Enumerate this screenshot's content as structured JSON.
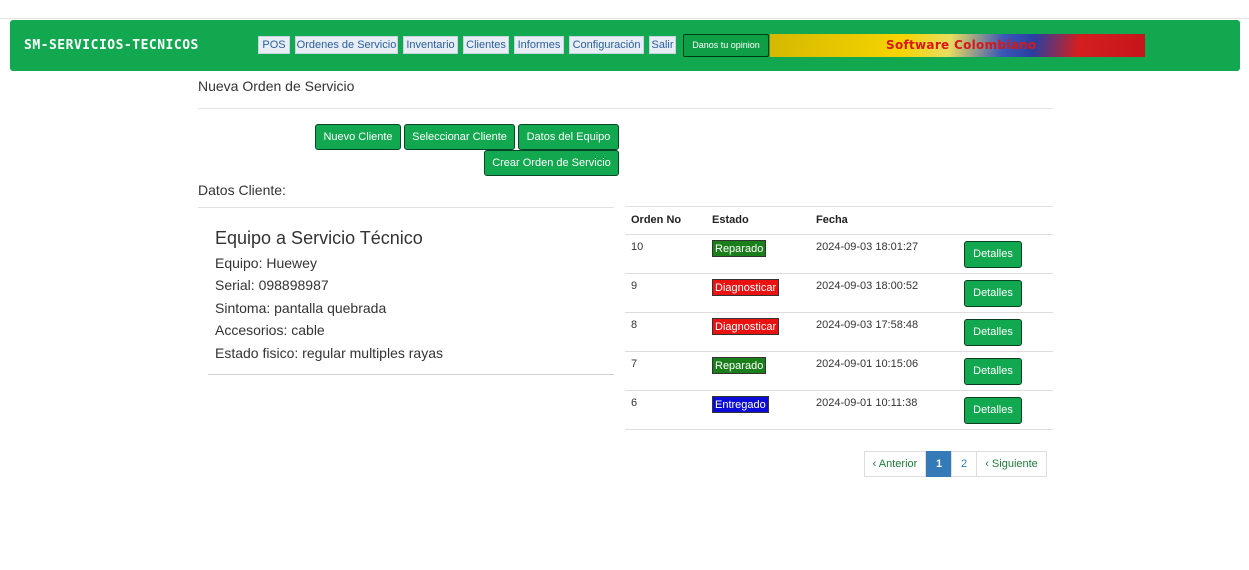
{
  "app": {
    "brand": "SM-SERVICIOS-TECNICOS"
  },
  "nav": {
    "items": [
      "POS",
      "Ordenes de Servicio",
      "Inventario",
      "Clientes",
      "Informes",
      "Configuración",
      "Salir"
    ],
    "opinion": "Danos tu opinion",
    "banner_text": "Software Colombiano"
  },
  "page": {
    "title": "Nueva Orden de Servicio"
  },
  "actions": {
    "nuevo_cliente": "Nuevo Cliente",
    "seleccionar_cliente": "Seleccionar Cliente",
    "datos_equipo": "Datos del Equipo",
    "crear_orden": "Crear Orden de Servicio"
  },
  "cliente": {
    "section_label": "Datos Cliente:"
  },
  "equipo": {
    "title": "Equipo a Servicio Técnico",
    "lines": [
      "Equipo: Huewey",
      "Serial: 098898987",
      "Sintoma: pantalla quebrada",
      "Accesorios: cable",
      "Estado fisico: regular multiples rayas"
    ]
  },
  "orders": {
    "headers": [
      "Orden No",
      "Estado",
      "Fecha"
    ],
    "detail_label": "Detalles",
    "rows": [
      {
        "num": "10",
        "estado": "Reparado",
        "estado_color": "#1a7f1a",
        "fecha": "2024-09-03 18:01:27"
      },
      {
        "num": "9",
        "estado": "Diagnosticar",
        "estado_color": "#ea1111",
        "fecha": "2024-09-03 18:00:52"
      },
      {
        "num": "8",
        "estado": "Diagnosticar",
        "estado_color": "#ea1111",
        "fecha": "2024-09-03 17:58:48"
      },
      {
        "num": "7",
        "estado": "Reparado",
        "estado_color": "#1a7f1a",
        "fecha": "2024-09-01 10:15:06"
      },
      {
        "num": "6",
        "estado": "Entregado",
        "estado_color": "#0b0bd8",
        "fecha": "2024-09-01 10:11:38"
      }
    ]
  },
  "pagination": {
    "prev": "‹ Anterior",
    "pages": [
      "1",
      "2"
    ],
    "current": "1",
    "next": "‹ Siguiente"
  }
}
